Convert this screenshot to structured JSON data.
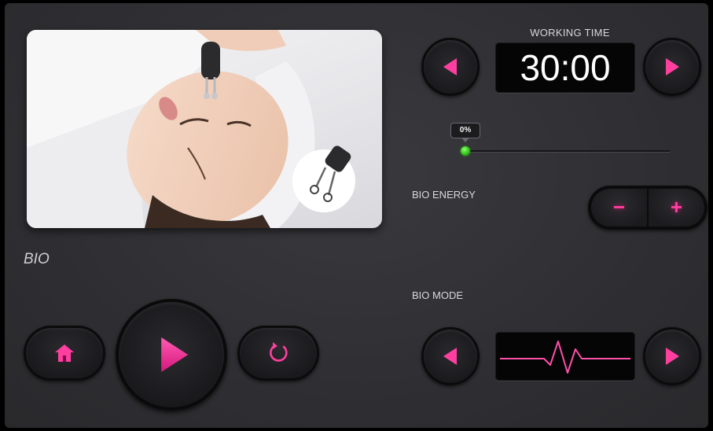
{
  "app": {
    "mode_title": "BIO"
  },
  "working_time": {
    "label": "WORKING TIME",
    "value": "30:00"
  },
  "energy_slider": {
    "tooltip": "0%",
    "level_percent": 0
  },
  "bio_energy": {
    "label": "BIO ENERGY",
    "minus_label": "−",
    "plus_label": "+"
  },
  "bio_mode": {
    "label": "BIO MODE",
    "waveform_icon": "pulse-waveform-icon"
  },
  "controls": {
    "home_icon": "home-icon",
    "play_icon": "play-icon",
    "reset_icon": "reset-icon"
  },
  "colors": {
    "accent": "#ff3fa0",
    "accent_glow": "#c0106a",
    "slider_knob": "#33c21a",
    "panel_bg": "#2f2f33"
  }
}
